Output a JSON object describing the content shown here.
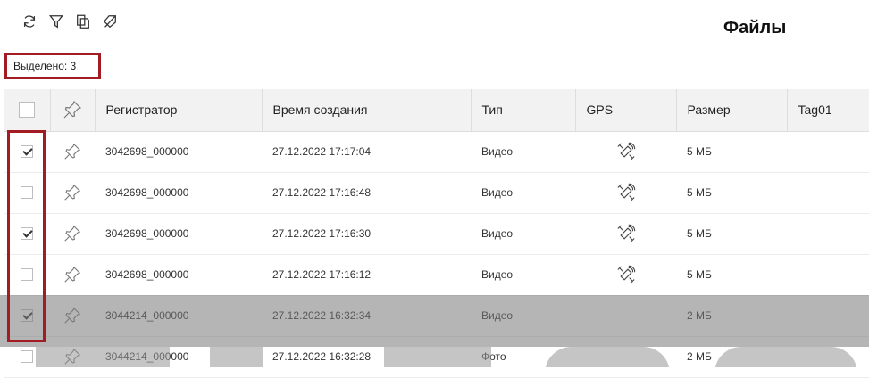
{
  "toolbar": {
    "items": [
      {
        "name": "refresh",
        "icon": "refresh-icon"
      },
      {
        "name": "filter",
        "icon": "filter-icon"
      },
      {
        "name": "copy",
        "icon": "copy-icon"
      },
      {
        "name": "clear-tags",
        "icon": "tag-off-icon"
      }
    ]
  },
  "page": {
    "title": "Файлы"
  },
  "selection": {
    "label": "Выделено: 3"
  },
  "table": {
    "columns": [
      "Регистратор",
      "Время создания",
      "Тип",
      "GPS",
      "Размер",
      "Tag01"
    ],
    "rows": [
      {
        "checked": true,
        "recorder": "3042698_000000",
        "created": "27.12.2022 17:17:04",
        "type": "Видео",
        "gps": true,
        "size": "5 МБ",
        "tag": ""
      },
      {
        "checked": false,
        "recorder": "3042698_000000",
        "created": "27.12.2022 17:16:48",
        "type": "Видео",
        "gps": true,
        "size": "5 МБ",
        "tag": ""
      },
      {
        "checked": true,
        "recorder": "3042698_000000",
        "created": "27.12.2022 17:16:30",
        "type": "Видео",
        "gps": true,
        "size": "5 МБ",
        "tag": ""
      },
      {
        "checked": false,
        "recorder": "3042698_000000",
        "created": "27.12.2022 17:16:12",
        "type": "Видео",
        "gps": true,
        "size": "5 МБ",
        "tag": ""
      },
      {
        "checked": true,
        "recorder": "3044214_000000",
        "created": "27.12.2022 16:32:34",
        "type": "Видео",
        "gps": false,
        "size": "2 МБ",
        "tag": ""
      },
      {
        "checked": false,
        "recorder": "3044214_000000",
        "created": "27.12.2022 16:32:28",
        "type": "Фото",
        "gps": false,
        "size": "2 МБ",
        "tag": ""
      }
    ]
  },
  "colors": {
    "highlight": "#a31c23",
    "header_bg": "#f2f2f2"
  }
}
